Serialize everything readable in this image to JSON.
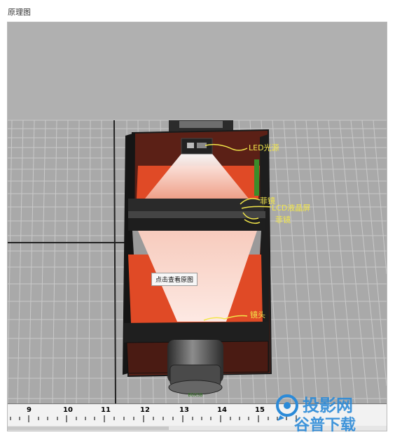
{
  "window": {
    "title": "原理图"
  },
  "annotations": {
    "led_light_source": "LED光源",
    "fresnel_top": "菲镜",
    "lcd_screen": "LCD液晶屏",
    "fresnel_bottom": "菲镜",
    "lens": "镜头"
  },
  "tooltip": {
    "text": "点击查看原图"
  },
  "lens_marking": "BOXSB",
  "ruler": {
    "ticks": [
      "9",
      "10",
      "11",
      "12",
      "13",
      "14",
      "15"
    ]
  },
  "watermark": {
    "line1": "投影网",
    "line2": "谷普下载"
  },
  "colors": {
    "housing": "#5b2016",
    "cone": "#f3b49f",
    "red_panel": "#e04a26",
    "annotation": "#f2e64a",
    "grid": "#a9a9a9"
  }
}
